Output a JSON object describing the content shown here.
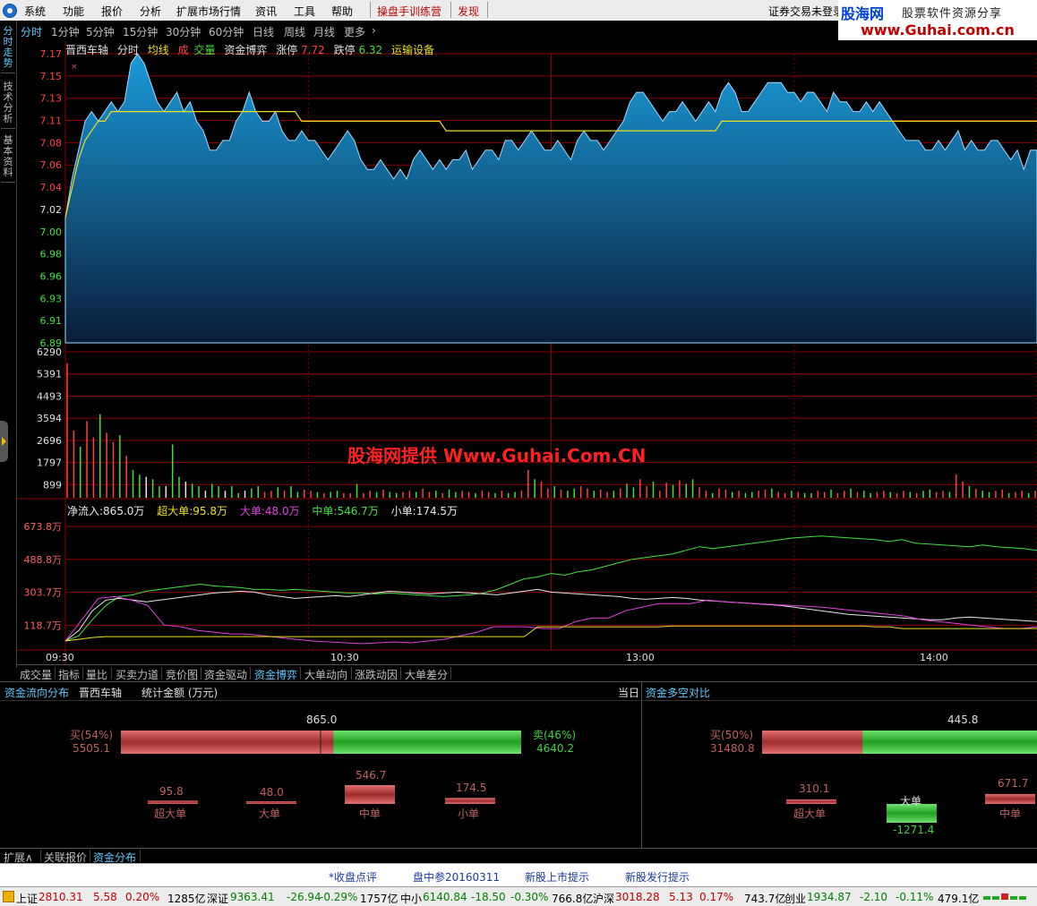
{
  "menu": {
    "items": [
      "系统",
      "功能",
      "报价",
      "分析",
      "扩展市场行情",
      "资讯",
      "工具",
      "帮助"
    ],
    "highlight_items": [
      "操盘手训练营",
      "发现"
    ],
    "account_status": "证券交易未登录"
  },
  "watermark": {
    "logo_text": "股海网",
    "tagline": "股票软件资源分享",
    "url": "www.Guhai.com.cn",
    "center_text": "股海网提供 Www.Guhai.Com.CN"
  },
  "side_tabs": [
    {
      "label": "分时走势",
      "active": true
    },
    {
      "label": "技术分析",
      "active": false
    },
    {
      "label": "基本资料",
      "active": false
    }
  ],
  "period_tabs": [
    {
      "label": "分时",
      "active": true
    },
    {
      "label": "1分钟",
      "active": false
    },
    {
      "label": "5分钟",
      "active": false
    },
    {
      "label": "15分钟",
      "active": false
    },
    {
      "label": "30分钟",
      "active": false
    },
    {
      "label": "60分钟",
      "active": false
    },
    {
      "label": "日线",
      "active": false
    },
    {
      "label": "周线",
      "active": false
    },
    {
      "label": "月线",
      "active": false
    },
    {
      "label": "更多",
      "active": false
    }
  ],
  "chart_header": {
    "stock_name": "晋西车轴",
    "mode": "分时",
    "avg_line": "均线",
    "volume_a": "成",
    "volume_b": "交量",
    "fund_game": "资金博弈",
    "limit_up_label": "涨停",
    "limit_up_value": "7.72",
    "limit_down_label": "跌停",
    "limit_down_value": "6.32",
    "sector": "运输设备"
  },
  "colors": {
    "price_fill_top": "#1a9ad8",
    "price_fill_bottom": "#0a1d3a",
    "avg_line": "#e8e020",
    "grid": "#8a0000",
    "up_red": "#ff4040",
    "down_green": "#40e040",
    "net_inflow": "#e8e8e8",
    "super_large": "#e8e020",
    "large": "#e040e0",
    "medium": "#40e040",
    "small": "#e8e8e8",
    "buy_bar": "#b03838",
    "sell_bar": "#30b030"
  },
  "chart_data": {
    "type": "line",
    "price_axis": [
      "7.17",
      "7.15",
      "7.13",
      "7.11",
      "7.08",
      "7.06",
      "7.04",
      "7.02",
      "7.00",
      "6.98",
      "6.96",
      "6.93",
      "6.91",
      "6.89"
    ],
    "prev_close": 7.02,
    "ylim": [
      6.87,
      7.17
    ],
    "price_series": [
      7.0,
      7.04,
      7.07,
      7.1,
      7.11,
      7.1,
      7.11,
      7.12,
      7.11,
      7.12,
      7.16,
      7.17,
      7.16,
      7.14,
      7.12,
      7.11,
      7.12,
      7.13,
      7.11,
      7.12,
      7.1,
      7.09,
      7.07,
      7.07,
      7.08,
      7.08,
      7.1,
      7.11,
      7.13,
      7.11,
      7.1,
      7.1,
      7.11,
      7.09,
      7.08,
      7.08,
      7.09,
      7.08,
      7.08,
      7.07,
      7.06,
      7.07,
      7.08,
      7.09,
      7.08,
      7.06,
      7.05,
      7.05,
      7.06,
      7.05,
      7.04,
      7.05,
      7.04,
      7.06,
      7.07,
      7.06,
      7.05,
      7.06,
      7.05,
      7.06,
      7.06,
      7.07,
      7.05,
      7.06,
      7.07,
      7.07,
      7.06,
      7.08,
      7.08,
      7.07,
      7.08,
      7.09,
      7.08,
      7.07,
      7.07,
      7.08,
      7.07,
      7.06,
      7.08,
      7.09,
      7.08,
      7.08,
      7.07,
      7.08,
      7.09,
      7.1,
      7.12,
      7.13,
      7.13,
      7.12,
      7.11,
      7.1,
      7.11,
      7.11,
      7.12,
      7.11,
      7.1,
      7.11,
      7.12,
      7.11,
      7.13,
      7.14,
      7.13,
      7.11,
      7.11,
      7.12,
      7.13,
      7.14,
      7.14,
      7.14,
      7.13,
      7.13,
      7.12,
      7.13,
      7.13,
      7.12,
      7.11,
      7.13,
      7.12,
      7.12,
      7.11,
      7.11,
      7.12,
      7.11,
      7.12,
      7.11,
      7.1,
      7.09,
      7.08,
      7.08,
      7.08,
      7.07,
      7.07,
      7.08,
      7.07,
      7.08,
      7.09,
      7.07,
      7.08,
      7.07,
      7.07,
      7.08,
      7.08,
      7.07,
      7.06,
      7.07,
      7.05,
      7.07,
      7.07
    ],
    "avg_series": [
      7.0,
      7.03,
      7.06,
      7.08,
      7.09,
      7.1,
      7.1,
      7.11,
      7.11,
      7.11,
      7.11,
      7.11,
      7.11,
      7.11,
      7.11,
      7.11,
      7.11,
      7.11,
      7.11,
      7.11,
      7.11,
      7.11,
      7.11,
      7.11,
      7.11,
      7.11,
      7.11,
      7.11,
      7.11,
      7.11,
      7.11,
      7.11,
      7.11,
      7.11,
      7.11,
      7.11,
      7.1,
      7.1,
      7.1,
      7.1,
      7.1,
      7.1,
      7.1,
      7.1,
      7.1,
      7.1,
      7.1,
      7.1,
      7.1,
      7.1,
      7.1,
      7.1,
      7.1,
      7.1,
      7.1,
      7.1,
      7.1,
      7.1,
      7.09,
      7.09,
      7.09,
      7.09,
      7.09,
      7.09,
      7.09,
      7.09,
      7.09,
      7.09,
      7.09,
      7.09,
      7.09,
      7.09,
      7.09,
      7.09,
      7.09,
      7.09,
      7.09,
      7.09,
      7.09,
      7.09,
      7.09,
      7.09,
      7.09,
      7.09,
      7.09,
      7.09,
      7.09,
      7.09,
      7.09,
      7.09,
      7.09,
      7.09,
      7.09,
      7.09,
      7.09,
      7.09,
      7.09,
      7.09,
      7.09,
      7.09,
      7.1,
      7.1,
      7.1,
      7.1,
      7.1,
      7.1,
      7.1,
      7.1,
      7.1,
      7.1,
      7.1,
      7.1,
      7.1,
      7.1,
      7.1,
      7.1,
      7.1,
      7.1,
      7.1,
      7.1,
      7.1,
      7.1,
      7.1,
      7.1,
      7.1,
      7.1,
      7.1,
      7.1,
      7.1,
      7.1,
      7.1,
      7.1,
      7.1,
      7.1,
      7.1,
      7.1,
      7.1,
      7.1,
      7.1,
      7.1,
      7.1,
      7.1,
      7.1,
      7.1,
      7.1,
      7.1,
      7.1,
      7.1,
      7.1,
      7.1
    ],
    "volume_axis": [
      "6290",
      "5391",
      "4493",
      "3594",
      "2696",
      "1797",
      "899"
    ],
    "volume_ylim": [
      0,
      6290
    ],
    "volume_series": [
      5800,
      2900,
      2200,
      3300,
      2600,
      3600,
      2800,
      2400,
      2700,
      1800,
      1200,
      1000,
      900,
      800,
      500,
      500,
      2300,
      900,
      700,
      600,
      500,
      300,
      600,
      500,
      300,
      500,
      200,
      300,
      400,
      500,
      250,
      300,
      450,
      300,
      500,
      250,
      350,
      300,
      250,
      200,
      250,
      300,
      200,
      200,
      600,
      200,
      300,
      250,
      350,
      250,
      200,
      250,
      300,
      250,
      400,
      250,
      300,
      200,
      350,
      250,
      300,
      250,
      200,
      300,
      250,
      200,
      300,
      200,
      250,
      300,
      1200,
      800,
      700,
      400,
      500,
      350,
      300,
      400,
      500,
      400,
      300,
      350,
      250,
      300,
      400,
      600,
      450,
      800,
      500,
      700,
      300,
      650,
      550,
      750,
      600,
      800,
      450,
      300,
      200,
      400,
      350,
      250,
      300,
      200,
      250,
      300,
      350,
      400,
      250,
      200,
      300,
      250,
      200,
      200,
      300,
      250,
      350,
      200,
      300,
      400,
      250,
      300,
      200,
      250,
      300,
      250,
      200,
      300,
      250,
      200,
      300,
      350,
      250,
      300,
      250,
      1000,
      700,
      500,
      400,
      300,
      250,
      300,
      350,
      200,
      250,
      300,
      200,
      300
    ],
    "volume_up": [
      1,
      1,
      0,
      1,
      1,
      0,
      1,
      1,
      0,
      1,
      0,
      0,
      0,
      0,
      0,
      0,
      0,
      0,
      0,
      0,
      0,
      0,
      0,
      0,
      0,
      0,
      0,
      0,
      0,
      0,
      1,
      1,
      0,
      1,
      0,
      0,
      1,
      1,
      0,
      1,
      0,
      0,
      1,
      1,
      0,
      1,
      1,
      0,
      1,
      0,
      0,
      1,
      1,
      0,
      1,
      1,
      0,
      1,
      0,
      0,
      1,
      1,
      0,
      1,
      1,
      0,
      1,
      0,
      0,
      1,
      1,
      0,
      1,
      1,
      0,
      1,
      0,
      0,
      1,
      1,
      0,
      1,
      1,
      0,
      1,
      0,
      0,
      1,
      1,
      0,
      1,
      1,
      0,
      1,
      0,
      0,
      1,
      1,
      0,
      1,
      1,
      0,
      1,
      0,
      0,
      1,
      1,
      0,
      1,
      1,
      0,
      1,
      0,
      0,
      1,
      1,
      0,
      1,
      1,
      0,
      1,
      0,
      0,
      1,
      1,
      0,
      1,
      1,
      0,
      1,
      0,
      0,
      1,
      1,
      0,
      1,
      1,
      0,
      1,
      0,
      0,
      1,
      1,
      0,
      1,
      1,
      0,
      1,
      0
    ],
    "fund_axis": [
      "673.8万",
      "488.8万",
      "303.7万",
      "118.7万"
    ],
    "fund_ylim": [
      0,
      750
    ],
    "time_axis": [
      "09:30",
      "10:30",
      "13:00",
      "14:00"
    ],
    "fund_legend": {
      "net": "净流入:865.0万",
      "super_large": "超大单:95.8万",
      "large": "大单:48.0万",
      "medium": "中单:546.7万",
      "small": "小单:174.5万"
    },
    "fund_series": [
      {
        "name": "中单",
        "values": [
          30,
          60,
          150,
          230,
          280,
          290,
          310,
          320,
          330,
          340,
          350,
          340,
          335,
          330,
          320,
          320,
          315,
          320,
          315,
          310,
          305,
          300,
          300,
          295,
          300,
          295,
          290,
          285,
          280,
          285,
          290,
          300,
          320,
          350,
          380,
          390,
          410,
          400,
          420,
          430,
          450,
          470,
          490,
          500,
          510,
          520,
          540,
          560,
          550,
          560,
          570,
          580,
          590,
          600,
          610,
          615,
          620,
          615,
          610,
          605,
          600,
          590,
          600,
          580,
          575,
          570,
          565,
          560,
          570,
          560,
          555,
          550,
          540
        ]
      },
      {
        "name": "小单",
        "values": [
          30,
          90,
          200,
          260,
          270,
          260,
          250,
          260,
          270,
          280,
          290,
          300,
          305,
          310,
          305,
          290,
          280,
          270,
          275,
          280,
          285,
          280,
          290,
          300,
          310,
          305,
          300,
          295,
          300,
          305,
          300,
          295,
          290,
          300,
          310,
          320,
          305,
          300,
          295,
          290,
          285,
          280,
          270,
          265,
          270,
          275,
          270,
          260,
          255,
          250,
          245,
          240,
          235,
          230,
          220,
          210,
          200,
          190,
          180,
          175,
          170,
          165,
          160,
          155,
          150,
          150,
          160,
          165,
          160,
          155,
          150,
          145,
          140
        ]
      },
      {
        "name": "大单",
        "values": [
          30,
          150,
          270,
          280,
          260,
          230,
          120,
          110,
          90,
          80,
          70,
          70,
          60,
          50,
          40,
          30,
          25,
          20,
          15,
          20,
          25,
          20,
          30,
          40,
          60,
          80,
          110,
          110,
          110,
          100,
          100,
          140,
          160,
          160,
          200,
          220,
          240,
          240,
          240,
          260,
          250,
          245,
          240,
          235,
          230,
          225,
          220,
          210,
          200,
          190,
          180,
          170,
          150,
          140,
          130,
          120,
          110,
          100,
          100,
          110
        ]
      },
      {
        "name": "超大单",
        "values": [
          30,
          40,
          50,
          55,
          55,
          55,
          55,
          55,
          55,
          55,
          55,
          55,
          55,
          55,
          55,
          55,
          55,
          55,
          55,
          55,
          55,
          55,
          55,
          55,
          55,
          55,
          55,
          55,
          55,
          55,
          55,
          55,
          55,
          55,
          55,
          110,
          110,
          110,
          110,
          110,
          110,
          110,
          110,
          110,
          110,
          115,
          115,
          115,
          115,
          115,
          115,
          115,
          115,
          115,
          115,
          115,
          115,
          115,
          115,
          115,
          110,
          110,
          100,
          100,
          100,
          100,
          100,
          100,
          100,
          100,
          100,
          100,
          100
        ]
      }
    ]
  },
  "bottom_tabs": [
    {
      "label": "成交量",
      "active": false
    },
    {
      "label": "指标",
      "active": false
    },
    {
      "label": "量比",
      "active": false
    },
    {
      "label": "买卖力道",
      "active": false
    },
    {
      "label": "竞价图",
      "active": false
    },
    {
      "label": "资金驱动",
      "active": false
    },
    {
      "label": "资金博弈",
      "active": true
    },
    {
      "label": "大单动向",
      "active": false
    },
    {
      "label": "涨跌动因",
      "active": false
    },
    {
      "label": "大单差分",
      "active": false
    }
  ],
  "lower_left": {
    "title": "资金流向分布",
    "stock": "晋西车轴",
    "unit": "统计金额 (万元)",
    "period": "当日",
    "net_value": "865.0",
    "buy_label": "买(54%)",
    "buy_value": "5505.1",
    "sell_label": "卖(46%)",
    "sell_value": "4640.2",
    "buy_ratio": 0.54,
    "orders": [
      {
        "label": "超大单",
        "value": "95.8",
        "amount": 95.8
      },
      {
        "label": "大单",
        "value": "48.0",
        "amount": 48.0
      },
      {
        "label": "中单",
        "value": "546.7",
        "amount": 546.7
      },
      {
        "label": "小单",
        "value": "174.5",
        "amount": 174.5
      }
    ]
  },
  "lower_right": {
    "title": "资金多空对比",
    "net_value": "445.8",
    "buy_label": "买(50%)",
    "buy_value": "31480.8",
    "buy_ratio": 0.5,
    "orders": [
      {
        "label": "超大单",
        "value": "310.1",
        "amount": 310.1
      },
      {
        "label": "大单",
        "value": "-1271.4",
        "amount": -1271.4
      },
      {
        "label": "中单",
        "value": "671.7",
        "amount": 671.7
      }
    ]
  },
  "footer_tabs": [
    {
      "label": "扩展∧",
      "active": false
    },
    {
      "label": "关联报价",
      "active": false
    },
    {
      "label": "资金分布",
      "active": true
    }
  ],
  "announcements": [
    "*收盘点评",
    "盘中参20160311",
    "新股上市提示",
    "新股发行提示"
  ],
  "status_bar": {
    "sh_label": "上证",
    "sh_value": "2810.31",
    "sh_change": "5.58",
    "sh_pct": "0.20%",
    "sh_amount": "1285亿",
    "sz_label": "深证",
    "sz_value": "9363.41",
    "sz_change": "-26.94",
    "sz_pct": "-0.29%",
    "sz_amount": "1757亿",
    "zx_label": "中小",
    "zx_value": "6140.84",
    "zx_change": "-18.50",
    "zx_pct": "-0.30%",
    "zx_amount": "766.8亿",
    "hs_label": "沪深",
    "hs_value": "3018.28",
    "hs_change": "5.13",
    "hs_pct": "0.17%",
    "hs_amount": "743.7亿",
    "cy_label": "创业",
    "cy_value": "1934.87",
    "cy_change": "-2.10",
    "cy_pct": "-0.11%",
    "cy_amount": "479.1亿"
  }
}
